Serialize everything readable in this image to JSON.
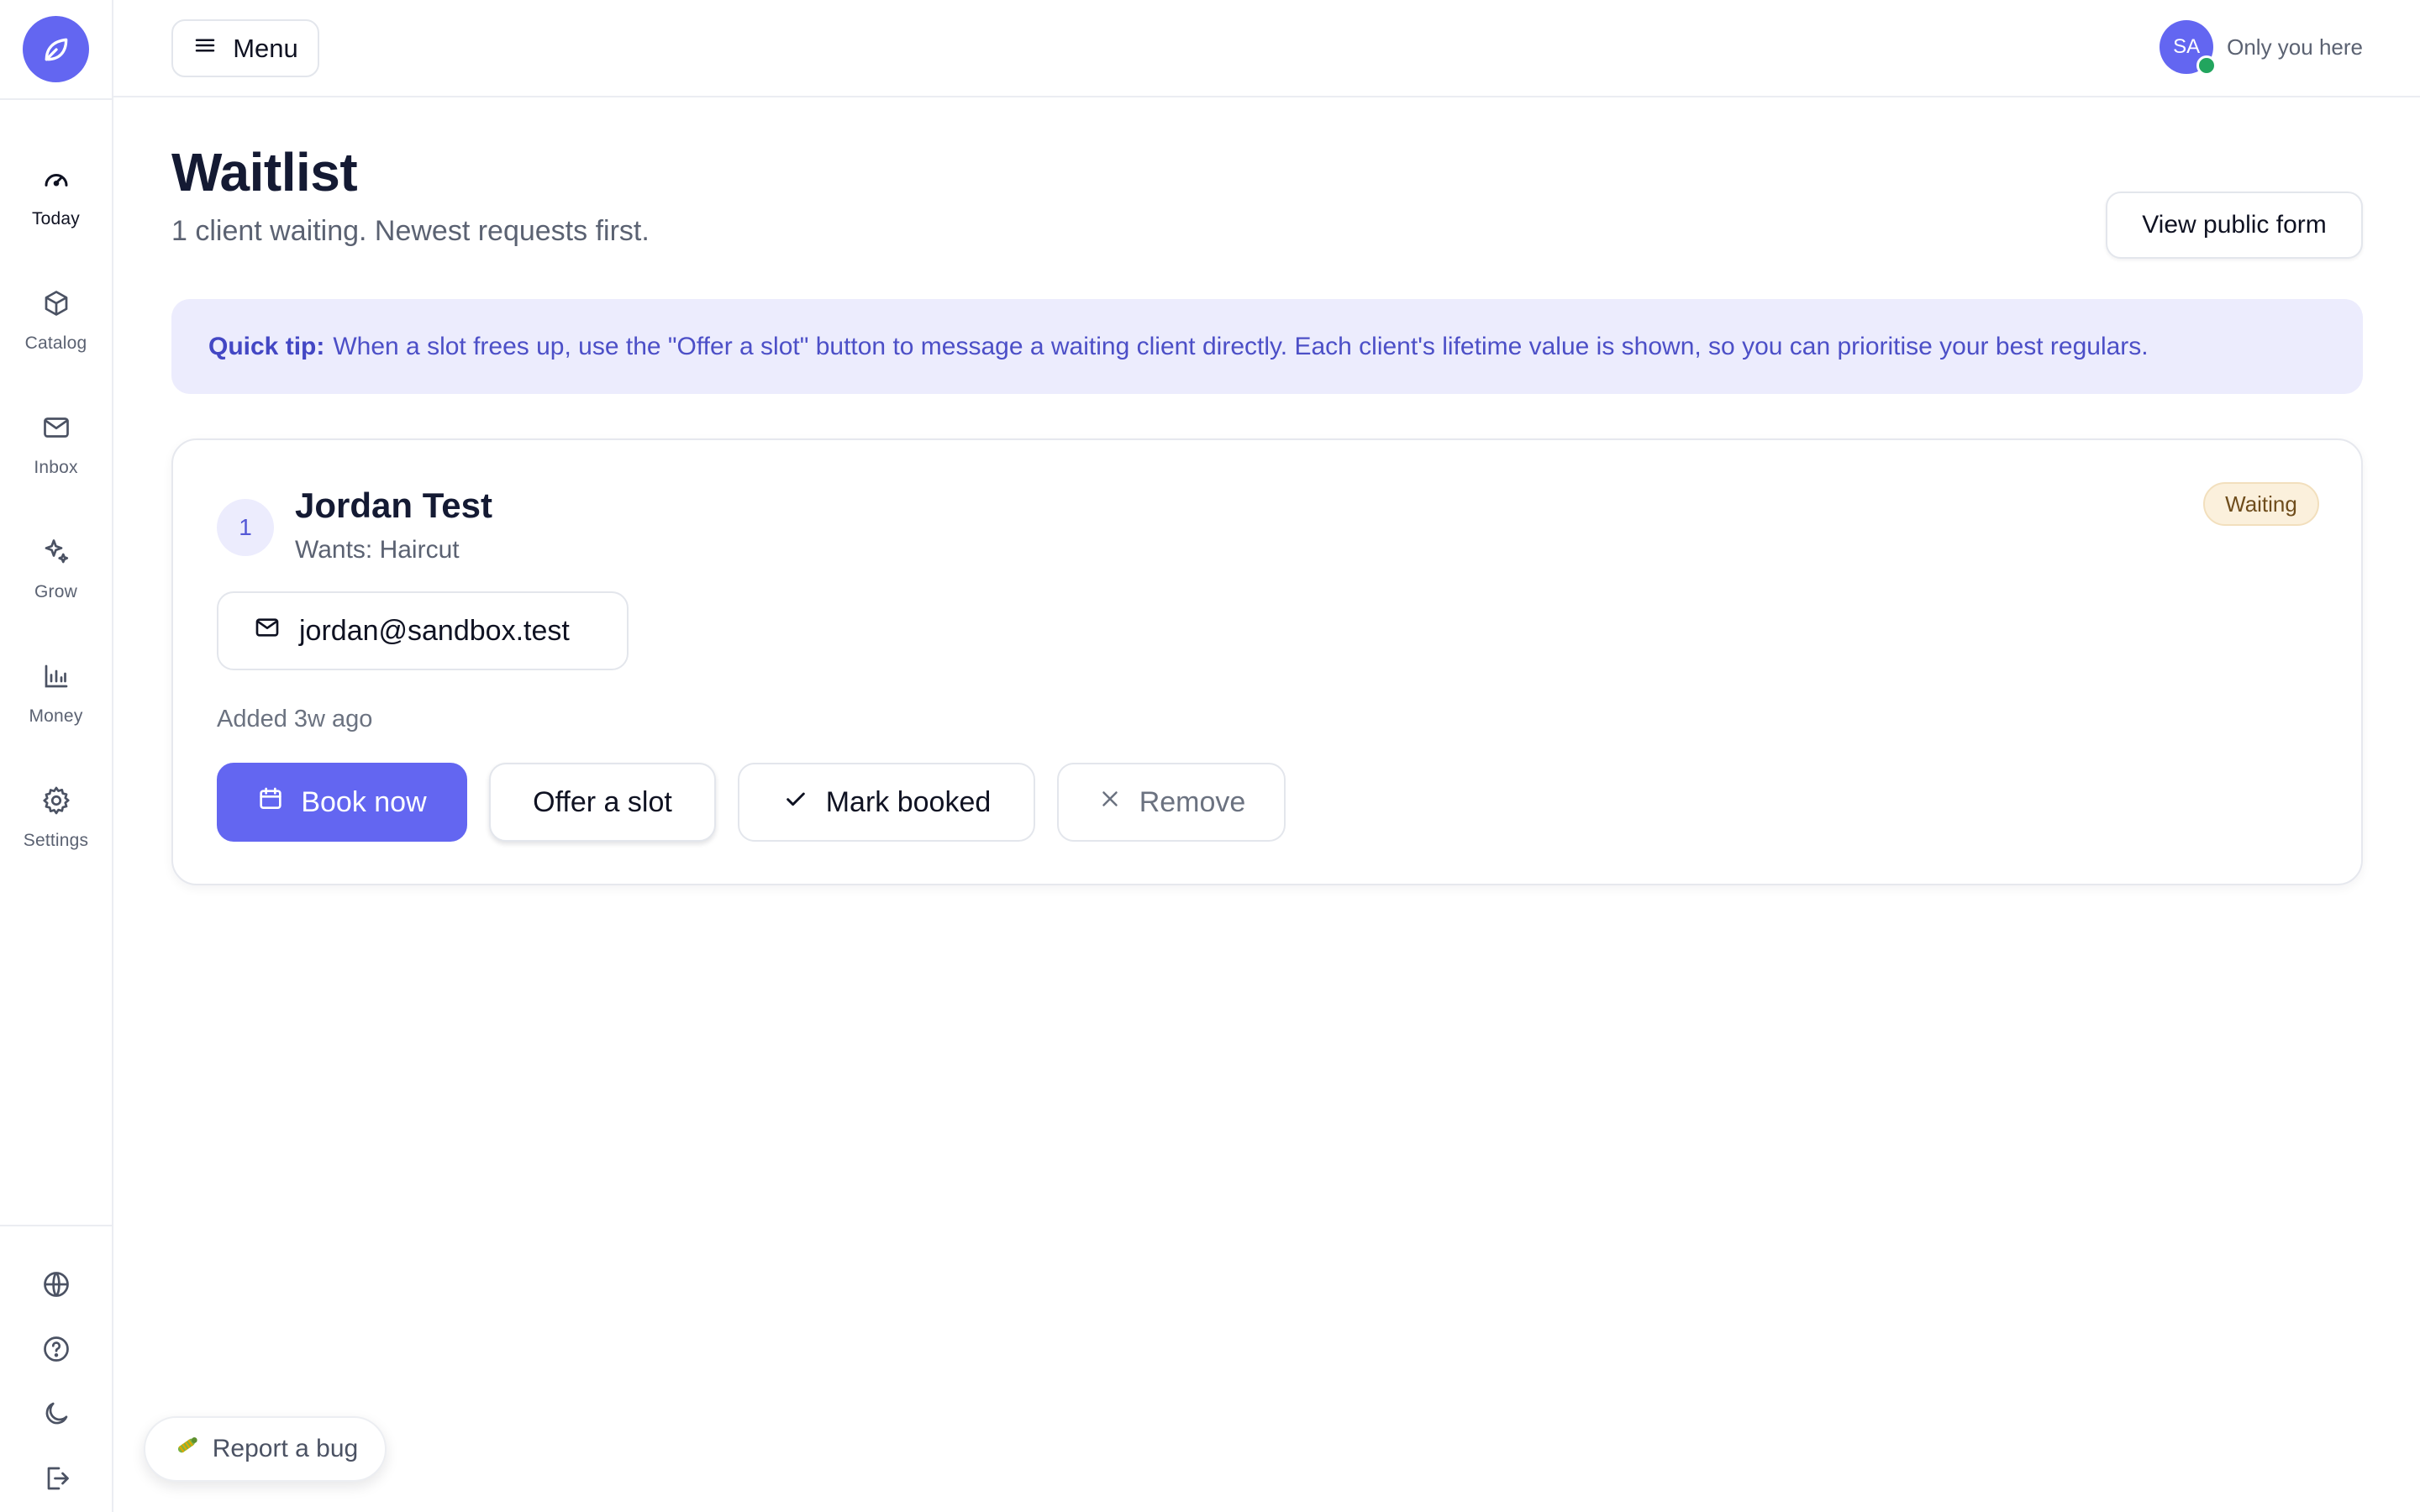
{
  "header": {
    "menu_label": "Menu",
    "avatar_initials": "SA",
    "presence_text": "Only you here"
  },
  "sidebar": {
    "items": [
      {
        "label": "Today",
        "icon": "gauge-icon",
        "active": true
      },
      {
        "label": "Catalog",
        "icon": "box-icon",
        "active": false
      },
      {
        "label": "Inbox",
        "icon": "mail-icon",
        "active": false
      },
      {
        "label": "Grow",
        "icon": "sparkle-icon",
        "active": false
      },
      {
        "label": "Money",
        "icon": "bar-chart-icon",
        "active": false
      },
      {
        "label": "Settings",
        "icon": "gear-icon",
        "active": false
      }
    ],
    "bottom_icons": [
      "globe-icon",
      "help-icon",
      "moon-icon",
      "logout-icon"
    ]
  },
  "page": {
    "title": "Waitlist",
    "subtitle": "1 client waiting. Newest requests first.",
    "view_form_label": "View public form"
  },
  "tip": {
    "label": "Quick tip:",
    "text": "When a slot frees up, use the \"Offer a slot\" button to message a waiting client directly. Each client's lifetime value is shown, so you can prioritise your best regulars."
  },
  "entry": {
    "rank": "1",
    "name": "Jordan Test",
    "wants": "Wants: Haircut",
    "status": "Waiting",
    "email": "jordan@sandbox.test",
    "added": "Added 3w ago",
    "actions": {
      "book": "Book now",
      "offer": "Offer a slot",
      "mark": "Mark booked",
      "remove": "Remove"
    }
  },
  "bug_button": "Report a bug",
  "colors": {
    "accent": "#6366f1",
    "tip_bg": "#ececfd",
    "status_bg": "#fbf0dc",
    "online": "#22a55e"
  }
}
